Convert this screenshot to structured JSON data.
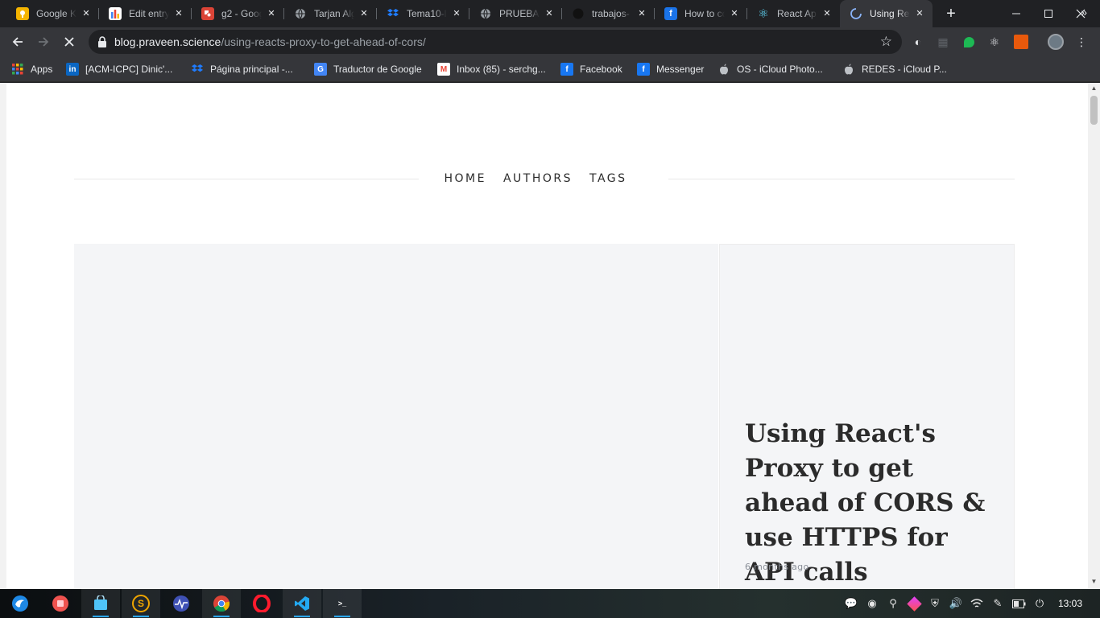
{
  "browser": {
    "tabs": [
      {
        "title": "Google K",
        "icon": "google-keep-icon",
        "color": "#f4b400",
        "glyph": ""
      },
      {
        "title": "Edit entry",
        "icon": "bar-chart-icon",
        "color": "#4285f4",
        "glyph": ""
      },
      {
        "title": "g2 - Goog",
        "icon": "google-drawings-icon",
        "color": "#db4437",
        "glyph": ""
      },
      {
        "title": "Tarjan Alg",
        "icon": "globe-icon",
        "color": "#9aa0a6",
        "glyph": ""
      },
      {
        "title": "Tema10-l",
        "icon": "dropbox-icon",
        "color": "#0061fe",
        "glyph": ""
      },
      {
        "title": "PRUEBA",
        "icon": "globe-icon",
        "color": "#9aa0a6",
        "glyph": ""
      },
      {
        "title": "trabajos-",
        "icon": "github-icon",
        "color": "#24292e",
        "glyph": ""
      },
      {
        "title": "How to co",
        "icon": "freecodecamp-icon",
        "color": "#1a73e8",
        "glyph": "f"
      },
      {
        "title": "React Ap",
        "icon": "react-icon",
        "color": "#35363a",
        "glyph": "⚛"
      },
      {
        "title": "Using Re",
        "icon": "loading-spinner-icon",
        "color": "#35363a",
        "glyph": "",
        "active": true
      }
    ],
    "new_tab_label": "+",
    "url_host": "blog.praveen.science",
    "url_path": "/using-reacts-proxy-to-get-ahead-of-cors/",
    "bookmarks": [
      {
        "label": "Apps",
        "icon": "apps-grid-icon",
        "color": "#35363a",
        "glyph": ""
      },
      {
        "label": "[ACM-ICPC] Dinic'...",
        "icon": "linkedin-icon",
        "color": "#0a66c2",
        "glyph": "in"
      },
      {
        "label": "Página principal -...",
        "icon": "dropbox-icon",
        "color": "#35363a",
        "glyph": ""
      },
      {
        "label": "Traductor de Google",
        "icon": "google-translate-icon",
        "color": "#4285f4",
        "glyph": "G"
      },
      {
        "label": "Inbox (85) - serchg...",
        "icon": "gmail-icon",
        "color": "#ffffff",
        "glyph": "M"
      },
      {
        "label": "Facebook",
        "icon": "facebook-icon",
        "color": "#1877f2",
        "glyph": "f"
      },
      {
        "label": "Messenger",
        "icon": "facebook-icon",
        "color": "#1877f2",
        "glyph": "f"
      },
      {
        "label": "OS - iCloud Photo...",
        "icon": "apple-icon",
        "color": "#35363a",
        "glyph": ""
      },
      {
        "label": "REDES - iCloud P...",
        "icon": "apple-icon",
        "color": "#35363a",
        "glyph": ""
      }
    ]
  },
  "site": {
    "nav": [
      {
        "label": "HOME"
      },
      {
        "label": "AUTHORS"
      },
      {
        "label": "TAGS"
      }
    ],
    "post": {
      "title": "Using React's Proxy to get ahead of CORS & use HTTPS for API calls",
      "date": "6 months ago"
    }
  },
  "taskbar": {
    "apps": [
      {
        "icon": "deepin-launcher-icon",
        "color": "#1e88e5",
        "glyph": "",
        "open": false
      },
      {
        "icon": "screen-recorder-icon",
        "color": "#ef5350",
        "glyph": "",
        "open": false
      },
      {
        "icon": "app-store-icon",
        "color": "#4fc3f7",
        "glyph": "",
        "open": true
      },
      {
        "icon": "sublime-s-icon",
        "color": "#3c3c3c",
        "glyph": "S",
        "open": true
      },
      {
        "icon": "system-monitor-icon",
        "color": "#3f51b5",
        "glyph": "",
        "open": false
      },
      {
        "icon": "chrome-icon",
        "color": "#4caf50",
        "glyph": "",
        "open": true
      },
      {
        "icon": "opera-icon",
        "color": "#e11d2b",
        "glyph": "O",
        "open": false
      },
      {
        "icon": "vscode-icon",
        "color": "#1e88e5",
        "glyph": "",
        "open": true
      },
      {
        "icon": "terminal-icon",
        "color": "#d32f2f",
        "glyph": ">_",
        "open": true
      }
    ],
    "clock": "13:03"
  }
}
